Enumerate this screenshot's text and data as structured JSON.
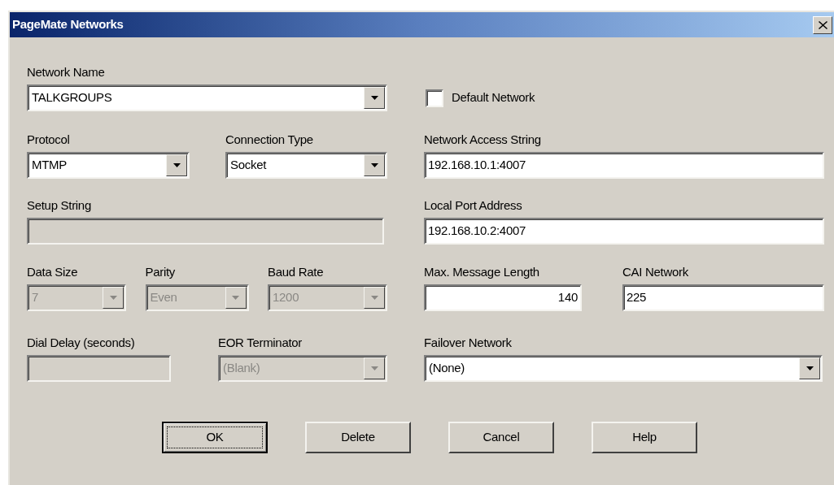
{
  "window": {
    "title": "PageMate Networks"
  },
  "network_name": {
    "label": "Network Name",
    "kind": "combo",
    "value": "TALKGROUPS",
    "disabled": false
  },
  "default_network": {
    "label": "Default Network",
    "checked": false
  },
  "protocol": {
    "label": "Protocol",
    "kind": "combo",
    "value": "MTMP",
    "disabled": false
  },
  "connection_type": {
    "label": "Connection Type",
    "kind": "combo",
    "value": "Socket",
    "disabled": false
  },
  "network_access_string": {
    "label": "Network Access String",
    "kind": "text",
    "value": "192.168.10.1:4007",
    "disabled": false
  },
  "setup_string": {
    "label": "Setup String",
    "kind": "text",
    "disabled": true
  },
  "local_port_address": {
    "label": "Local Port Address",
    "kind": "text",
    "value": "192.168.10.2:4007",
    "disabled": false
  },
  "data_size": {
    "label": "Data Size",
    "kind": "combo",
    "value": "7",
    "disabled": true
  },
  "parity": {
    "label": "Parity",
    "kind": "combo",
    "value": "Even",
    "disabled": true
  },
  "baud_rate": {
    "label": "Baud Rate",
    "kind": "combo",
    "value": "1200",
    "disabled": true
  },
  "max_message_length": {
    "label": "Max. Message Length",
    "kind": "number",
    "value": "140",
    "disabled": false
  },
  "cai_network": {
    "label": "CAI Network",
    "kind": "text",
    "value": "225",
    "disabled": false
  },
  "dial_delay": {
    "label": "Dial Delay (seconds)",
    "kind": "text",
    "disabled": true
  },
  "eor_terminator": {
    "label": "EOR Terminator",
    "kind": "combo",
    "value": "(Blank)",
    "disabled": true
  },
  "failover_network": {
    "label": "Failover Network",
    "kind": "combo",
    "value": "(None)",
    "disabled": false
  },
  "buttons": [
    {
      "label": "OK",
      "default": true
    },
    {
      "label": "Delete",
      "default": false
    },
    {
      "label": "Cancel",
      "default": false
    },
    {
      "label": "Help",
      "default": false
    }
  ]
}
